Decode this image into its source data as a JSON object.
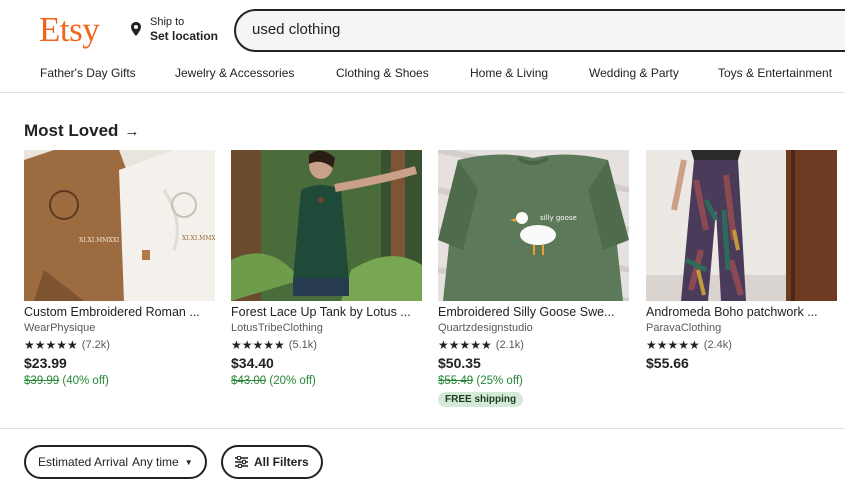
{
  "header": {
    "logo": "Etsy",
    "ship_small": "Ship to",
    "ship_big": "Set location",
    "search_value": "used clothing"
  },
  "categories": [
    "Father's Day Gifts",
    "Jewelry & Accessories",
    "Clothing & Shoes",
    "Home & Living",
    "Wedding & Party",
    "Toys & Entertainment"
  ],
  "section": {
    "title": "Most Loved",
    "arrow": "→"
  },
  "products": [
    {
      "title": "Custom Embroidered Roman ...",
      "shop": "WearPhysique",
      "stars": "★★★★★",
      "reviews": "(7.2k)",
      "price": "$23.99",
      "original_price": "$39.99",
      "discount": "(40% off)",
      "badge": ""
    },
    {
      "title": "Forest Lace Up Tank by Lotus ...",
      "shop": "LotusTribeClothing",
      "stars": "★★★★★",
      "reviews": "(5.1k)",
      "price": "$34.40",
      "original_price": "$43.00",
      "discount": "(20% off)",
      "badge": ""
    },
    {
      "title": "Embroidered Silly Goose Swe...",
      "shop": "Quartzdesignstudio",
      "stars": "★★★★★",
      "reviews": "(2.1k)",
      "price": "$50.35",
      "original_price": "$55.49",
      "discount": "(25% off)",
      "badge": "FREE shipping"
    },
    {
      "title": "Andromeda Boho patchwork ...",
      "shop": "ParavaClothing",
      "stars": "★★★★★",
      "reviews": "(2.4k)",
      "price": "$55.66",
      "original_price": "",
      "discount": "",
      "badge": ""
    }
  ],
  "filters": {
    "arrival_label": "Estimated Arrival",
    "arrival_value": "Any time",
    "caret": "▼",
    "all_filters": "All Filters"
  },
  "colors": {
    "brand": "#f1641e",
    "sale_green": "#258635",
    "badge_bg": "#d4e9d7"
  }
}
